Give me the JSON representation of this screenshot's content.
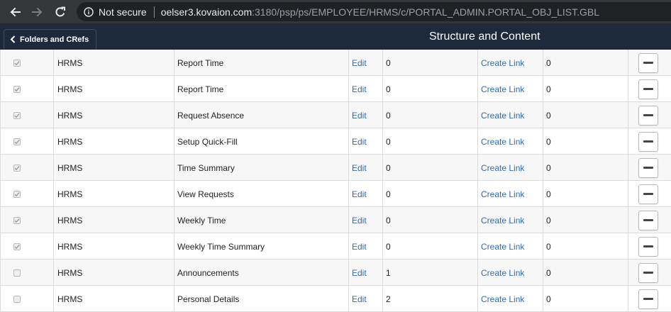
{
  "browser": {
    "security_label": "Not secure",
    "url_host": "oelser3.kovaion.com",
    "url_rest": ":3180/psp/ps/EMPLOYEE/HRMS/c/PORTAL_ADMIN.PORTAL_OBJ_LIST.GBL"
  },
  "header": {
    "folders_button": "Folders and CRefs",
    "title": "Structure and Content"
  },
  "rows": [
    {
      "checked": true,
      "node": "HRMS",
      "label": "Report Time",
      "edit": "Edit",
      "seq": "0",
      "link": "Create Link",
      "num": "0"
    },
    {
      "checked": true,
      "node": "HRMS",
      "label": "Report Time",
      "edit": "Edit",
      "seq": "0",
      "link": "Create Link",
      "num": "0"
    },
    {
      "checked": true,
      "node": "HRMS",
      "label": "Request Absence",
      "edit": "Edit",
      "seq": "0",
      "link": "Create Link",
      "num": "0"
    },
    {
      "checked": true,
      "node": "HRMS",
      "label": "Setup Quick-Fill",
      "edit": "Edit",
      "seq": "0",
      "link": "Create Link",
      "num": "0"
    },
    {
      "checked": true,
      "node": "HRMS",
      "label": "Time Summary",
      "edit": "Edit",
      "seq": "0",
      "link": "Create Link",
      "num": "0"
    },
    {
      "checked": true,
      "node": "HRMS",
      "label": "View Requests",
      "edit": "Edit",
      "seq": "0",
      "link": "Create Link",
      "num": "0"
    },
    {
      "checked": true,
      "node": "HRMS",
      "label": "Weekly Time",
      "edit": "Edit",
      "seq": "0",
      "link": "Create Link",
      "num": "0"
    },
    {
      "checked": true,
      "node": "HRMS",
      "label": "Weekly Time Summary",
      "edit": "Edit",
      "seq": "0",
      "link": "Create Link",
      "num": "0"
    },
    {
      "checked": false,
      "node": "HRMS",
      "label": "Announcements",
      "edit": "Edit",
      "seq": "1",
      "link": "Create Link",
      "num": "0"
    },
    {
      "checked": false,
      "node": "HRMS",
      "label": "Personal Details",
      "edit": "Edit",
      "seq": "2",
      "link": "Create Link",
      "num": "0"
    }
  ]
}
